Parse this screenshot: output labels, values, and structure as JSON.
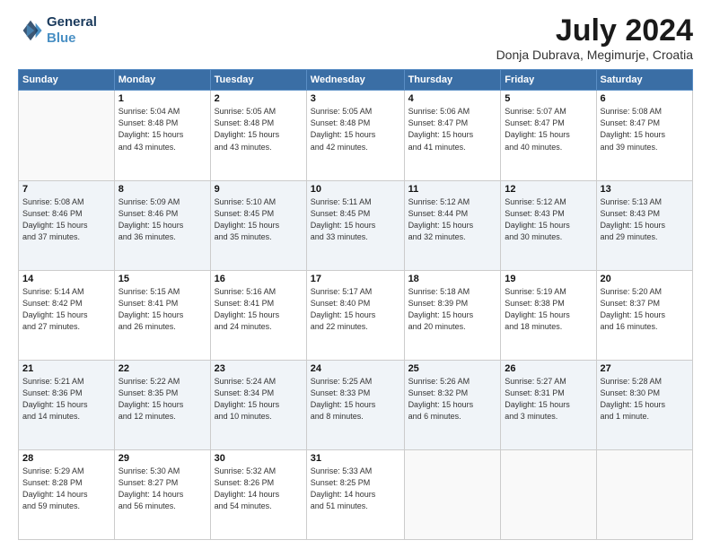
{
  "logo": {
    "line1": "General",
    "line2": "Blue"
  },
  "title": "July 2024",
  "subtitle": "Donja Dubrava, Megimurje, Croatia",
  "weekdays": [
    "Sunday",
    "Monday",
    "Tuesday",
    "Wednesday",
    "Thursday",
    "Friday",
    "Saturday"
  ],
  "weeks": [
    [
      {
        "day": "",
        "info": ""
      },
      {
        "day": "1",
        "info": "Sunrise: 5:04 AM\nSunset: 8:48 PM\nDaylight: 15 hours\nand 43 minutes."
      },
      {
        "day": "2",
        "info": "Sunrise: 5:05 AM\nSunset: 8:48 PM\nDaylight: 15 hours\nand 43 minutes."
      },
      {
        "day": "3",
        "info": "Sunrise: 5:05 AM\nSunset: 8:48 PM\nDaylight: 15 hours\nand 42 minutes."
      },
      {
        "day": "4",
        "info": "Sunrise: 5:06 AM\nSunset: 8:47 PM\nDaylight: 15 hours\nand 41 minutes."
      },
      {
        "day": "5",
        "info": "Sunrise: 5:07 AM\nSunset: 8:47 PM\nDaylight: 15 hours\nand 40 minutes."
      },
      {
        "day": "6",
        "info": "Sunrise: 5:08 AM\nSunset: 8:47 PM\nDaylight: 15 hours\nand 39 minutes."
      }
    ],
    [
      {
        "day": "7",
        "info": "Sunrise: 5:08 AM\nSunset: 8:46 PM\nDaylight: 15 hours\nand 37 minutes."
      },
      {
        "day": "8",
        "info": "Sunrise: 5:09 AM\nSunset: 8:46 PM\nDaylight: 15 hours\nand 36 minutes."
      },
      {
        "day": "9",
        "info": "Sunrise: 5:10 AM\nSunset: 8:45 PM\nDaylight: 15 hours\nand 35 minutes."
      },
      {
        "day": "10",
        "info": "Sunrise: 5:11 AM\nSunset: 8:45 PM\nDaylight: 15 hours\nand 33 minutes."
      },
      {
        "day": "11",
        "info": "Sunrise: 5:12 AM\nSunset: 8:44 PM\nDaylight: 15 hours\nand 32 minutes."
      },
      {
        "day": "12",
        "info": "Sunrise: 5:12 AM\nSunset: 8:43 PM\nDaylight: 15 hours\nand 30 minutes."
      },
      {
        "day": "13",
        "info": "Sunrise: 5:13 AM\nSunset: 8:43 PM\nDaylight: 15 hours\nand 29 minutes."
      }
    ],
    [
      {
        "day": "14",
        "info": "Sunrise: 5:14 AM\nSunset: 8:42 PM\nDaylight: 15 hours\nand 27 minutes."
      },
      {
        "day": "15",
        "info": "Sunrise: 5:15 AM\nSunset: 8:41 PM\nDaylight: 15 hours\nand 26 minutes."
      },
      {
        "day": "16",
        "info": "Sunrise: 5:16 AM\nSunset: 8:41 PM\nDaylight: 15 hours\nand 24 minutes."
      },
      {
        "day": "17",
        "info": "Sunrise: 5:17 AM\nSunset: 8:40 PM\nDaylight: 15 hours\nand 22 minutes."
      },
      {
        "day": "18",
        "info": "Sunrise: 5:18 AM\nSunset: 8:39 PM\nDaylight: 15 hours\nand 20 minutes."
      },
      {
        "day": "19",
        "info": "Sunrise: 5:19 AM\nSunset: 8:38 PM\nDaylight: 15 hours\nand 18 minutes."
      },
      {
        "day": "20",
        "info": "Sunrise: 5:20 AM\nSunset: 8:37 PM\nDaylight: 15 hours\nand 16 minutes."
      }
    ],
    [
      {
        "day": "21",
        "info": "Sunrise: 5:21 AM\nSunset: 8:36 PM\nDaylight: 15 hours\nand 14 minutes."
      },
      {
        "day": "22",
        "info": "Sunrise: 5:22 AM\nSunset: 8:35 PM\nDaylight: 15 hours\nand 12 minutes."
      },
      {
        "day": "23",
        "info": "Sunrise: 5:24 AM\nSunset: 8:34 PM\nDaylight: 15 hours\nand 10 minutes."
      },
      {
        "day": "24",
        "info": "Sunrise: 5:25 AM\nSunset: 8:33 PM\nDaylight: 15 hours\nand 8 minutes."
      },
      {
        "day": "25",
        "info": "Sunrise: 5:26 AM\nSunset: 8:32 PM\nDaylight: 15 hours\nand 6 minutes."
      },
      {
        "day": "26",
        "info": "Sunrise: 5:27 AM\nSunset: 8:31 PM\nDaylight: 15 hours\nand 3 minutes."
      },
      {
        "day": "27",
        "info": "Sunrise: 5:28 AM\nSunset: 8:30 PM\nDaylight: 15 hours\nand 1 minute."
      }
    ],
    [
      {
        "day": "28",
        "info": "Sunrise: 5:29 AM\nSunset: 8:28 PM\nDaylight: 14 hours\nand 59 minutes."
      },
      {
        "day": "29",
        "info": "Sunrise: 5:30 AM\nSunset: 8:27 PM\nDaylight: 14 hours\nand 56 minutes."
      },
      {
        "day": "30",
        "info": "Sunrise: 5:32 AM\nSunset: 8:26 PM\nDaylight: 14 hours\nand 54 minutes."
      },
      {
        "day": "31",
        "info": "Sunrise: 5:33 AM\nSunset: 8:25 PM\nDaylight: 14 hours\nand 51 minutes."
      },
      {
        "day": "",
        "info": ""
      },
      {
        "day": "",
        "info": ""
      },
      {
        "day": "",
        "info": ""
      }
    ]
  ]
}
